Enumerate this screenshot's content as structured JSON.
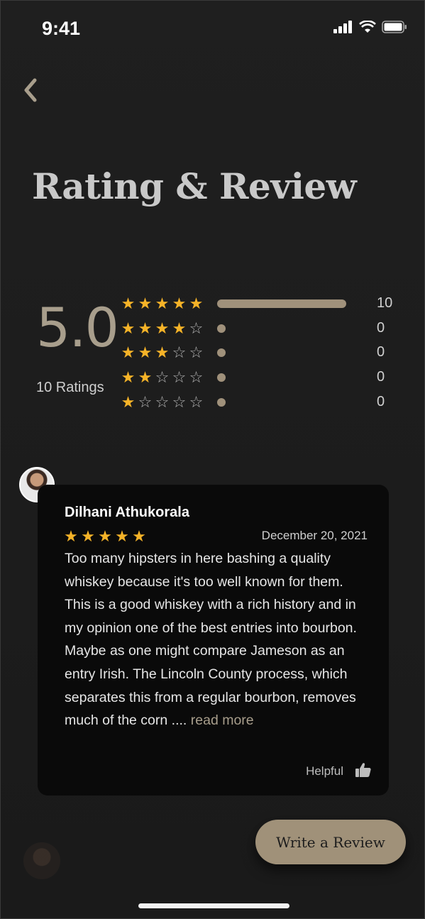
{
  "status_bar": {
    "time": "9:41"
  },
  "header": {
    "title": "Rating & Review"
  },
  "summary": {
    "average": "5.0",
    "ratings_label": "10 Ratings",
    "distribution": [
      {
        "stars": 5,
        "count": "10",
        "fraction": 1.0
      },
      {
        "stars": 4,
        "count": "0",
        "fraction": 0.0
      },
      {
        "stars": 3,
        "count": "0",
        "fraction": 0.0
      },
      {
        "stars": 2,
        "count": "0",
        "fraction": 0.0
      },
      {
        "stars": 1,
        "count": "0",
        "fraction": 0.0
      }
    ]
  },
  "review": {
    "name": "Dilhani Athukorala",
    "stars": 5,
    "date": "December 20, 2021",
    "text": "Too many hipsters in here bashing a quality whiskey because it's too well known for them. This is a good whiskey with a rich history and in my opinion one of the best entries into bourbon. Maybe as one might compare Jameson as an entry Irish. The Lincoln County process, which separates this from a regular bourbon, removes much of the corn",
    "ellipsis": " .... ",
    "read_more": "read more",
    "helpful_label": "Helpful"
  },
  "actions": {
    "write_review": "Write a Review"
  },
  "colors": {
    "accent": "#a09179",
    "star": "#f5b328",
    "background": "#1c1c1c",
    "card": "#0a0a0a"
  },
  "icons": [
    "back-chevron-icon",
    "signal-icon",
    "wifi-icon",
    "battery-icon",
    "star-icon",
    "thumbs-up-icon"
  ]
}
